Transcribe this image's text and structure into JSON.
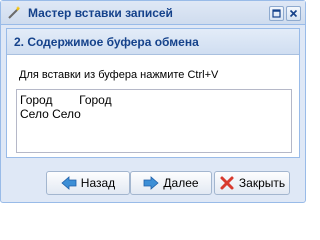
{
  "window": {
    "title": "Мастер вставки записей"
  },
  "step": {
    "title": "2. Содержимое буфера обмена",
    "instruction": "Для вставки из буфера нажмите Ctrl+V",
    "content": "Город        Город\nСело Село"
  },
  "buttons": {
    "back": "Назад",
    "next": "Далее",
    "close": "Закрыть"
  },
  "colors": {
    "accent_text": "#15428b",
    "border": "#99bbe8",
    "arrow_blue": "#3d8fd6",
    "close_red": "#d83a2e"
  },
  "icons": {
    "title": "wand-icon",
    "back": "arrow-left-icon",
    "next": "arrow-right-icon",
    "close": "close-x-icon"
  }
}
